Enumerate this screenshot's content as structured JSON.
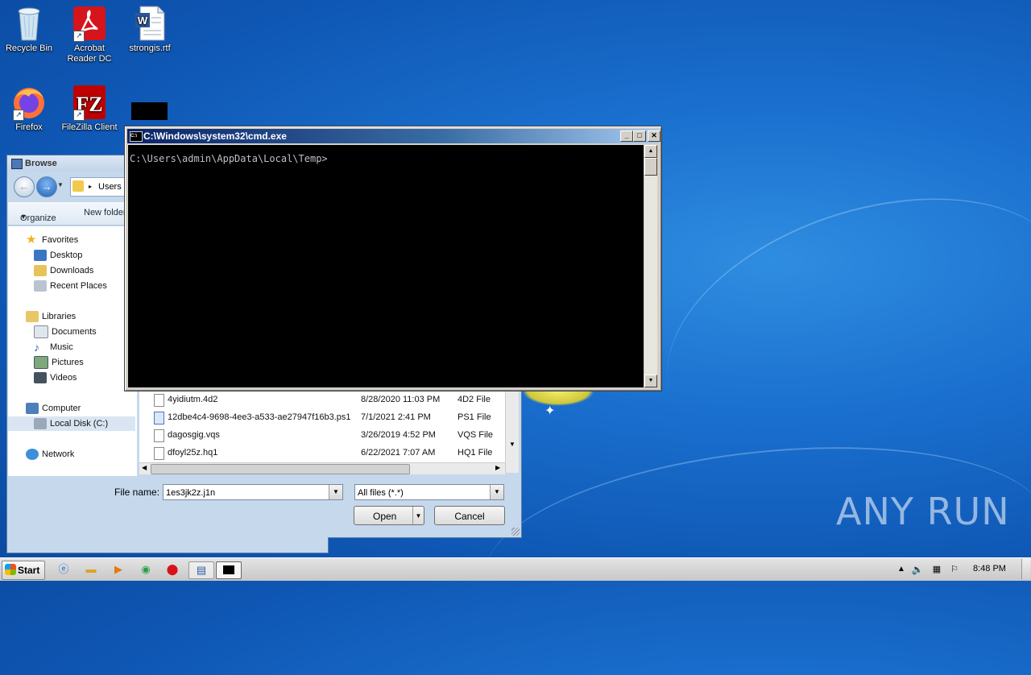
{
  "desktop": {
    "icons": [
      {
        "label": "Recycle Bin",
        "icon": "recycle-bin-icon"
      },
      {
        "label": "Acrobat Reader DC",
        "label_line1": "Acrobat",
        "label_line2": "Reader DC",
        "icon": "acrobat-icon"
      },
      {
        "label": "strongis.rtf",
        "icon": "word-document-icon"
      },
      {
        "label": "Firefox",
        "icon": "firefox-icon"
      },
      {
        "label": "FileZilla Client",
        "icon": "filezilla-icon"
      }
    ],
    "watermark": "ANY RUN"
  },
  "browse_dialog": {
    "title": "Browse",
    "breadcrumb": "Users",
    "toolbar": {
      "organize": "Organize",
      "new_folder": "New folder"
    },
    "nav": {
      "favorites": "Favorites",
      "desktop": "Desktop",
      "downloads": "Downloads",
      "recent": "Recent Places",
      "libraries": "Libraries",
      "documents": "Documents",
      "music": "Music",
      "pictures": "Pictures",
      "videos": "Videos",
      "computer": "Computer",
      "local_disk": "Local Disk (C:)",
      "network": "Network"
    },
    "files": [
      {
        "name": "4yidiutm.4d2",
        "date": "8/28/2020 11:03 PM",
        "type": "4D2 File"
      },
      {
        "name": "12dbe4c4-9698-4ee3-a533-ae27947f16b3.ps1",
        "date": "7/1/2021 2:41 PM",
        "type": "PS1 File"
      },
      {
        "name": "dagosgig.vqs",
        "date": "3/26/2019 4:52 PM",
        "type": "VQS File"
      },
      {
        "name": "dfoyl25z.hq1",
        "date": "6/22/2021 7:07 AM",
        "type": "HQ1 File"
      }
    ],
    "file_name_label": "File name:",
    "file_name_value": "1es3jk2z.j1n",
    "filter_value": "All files (*.*)",
    "open_label": "Open",
    "cancel_label": "Cancel"
  },
  "cmd_window": {
    "title": "C:\\Windows\\system32\\cmd.exe",
    "prompt": "C:\\Users\\admin\\AppData\\Local\\Temp>"
  },
  "taskbar": {
    "start_label": "Start",
    "clock": "8:48 PM"
  }
}
